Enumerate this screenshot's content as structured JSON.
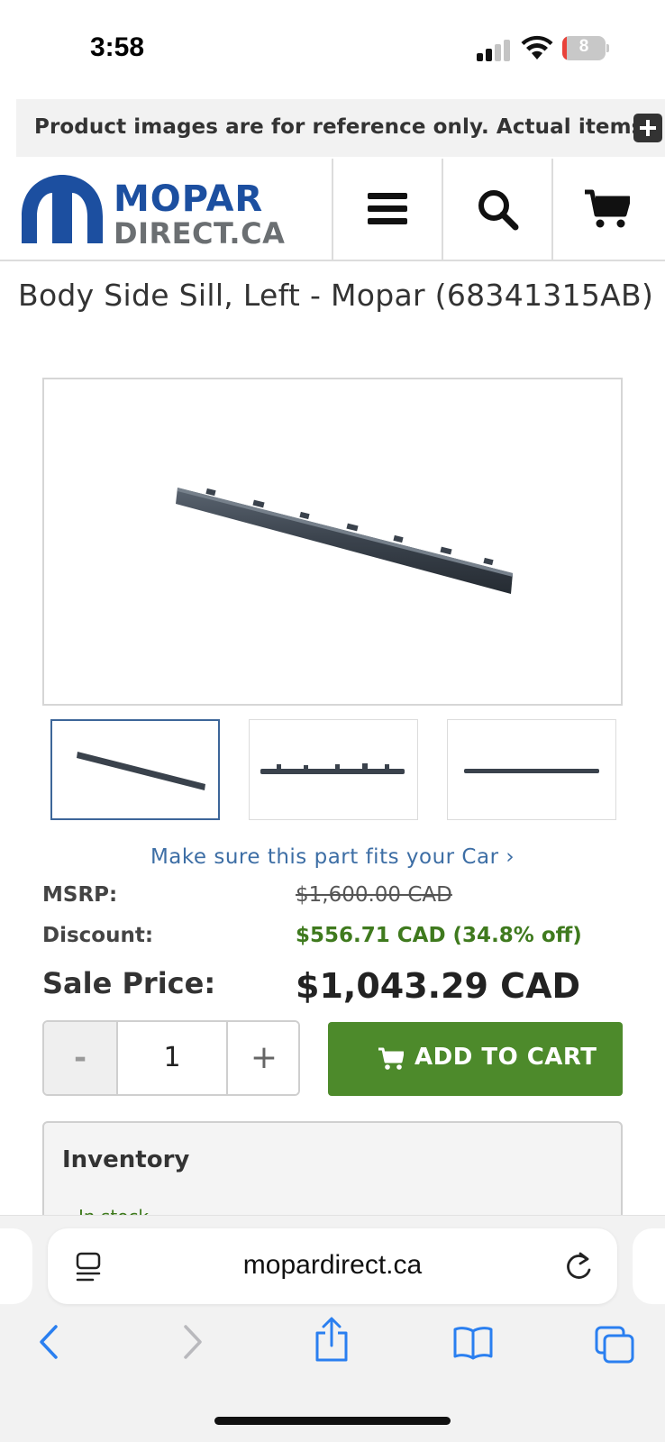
{
  "status_bar": {
    "time": "3:58",
    "battery_level": "8",
    "battery_color": "#e9423a",
    "icons": [
      "signal-icon",
      "wifi-icon",
      "battery-icon"
    ]
  },
  "notice": {
    "text": "Product images are for reference only. Actual items m",
    "icon": "plus-icon"
  },
  "header": {
    "logo_line1": "MOPAR",
    "logo_line2": "DIRECT.CA",
    "brand_blue": "#1c4fa0",
    "brand_gray": "#6b6f72",
    "icons": [
      "menu-icon",
      "search-icon",
      "cart-icon"
    ]
  },
  "product": {
    "title": "Body Side Sill, Left - Mopar (68341315AB)",
    "fit_link": "Make sure this part fits your Car ›",
    "msrp_label": "MSRP:",
    "msrp_value": "$1,600.00 CAD",
    "discount_label": "Discount:",
    "discount_value": "$556.71 CAD (34.8% off)",
    "sale_label": "Sale Price:",
    "sale_value": "$1,043.29 CAD",
    "accent_green": "#4d8a2b"
  },
  "purchase": {
    "minus": "-",
    "quantity": "1",
    "plus": "+",
    "add_to_cart": "ADD TO CART"
  },
  "inventory": {
    "title": "Inventory",
    "status": "In stock"
  },
  "browser": {
    "url": "mopardirect.ca",
    "icons": [
      "reader-icon",
      "reload-icon",
      "back-icon",
      "forward-icon",
      "share-icon",
      "bookmarks-icon",
      "tabs-icon"
    ]
  }
}
